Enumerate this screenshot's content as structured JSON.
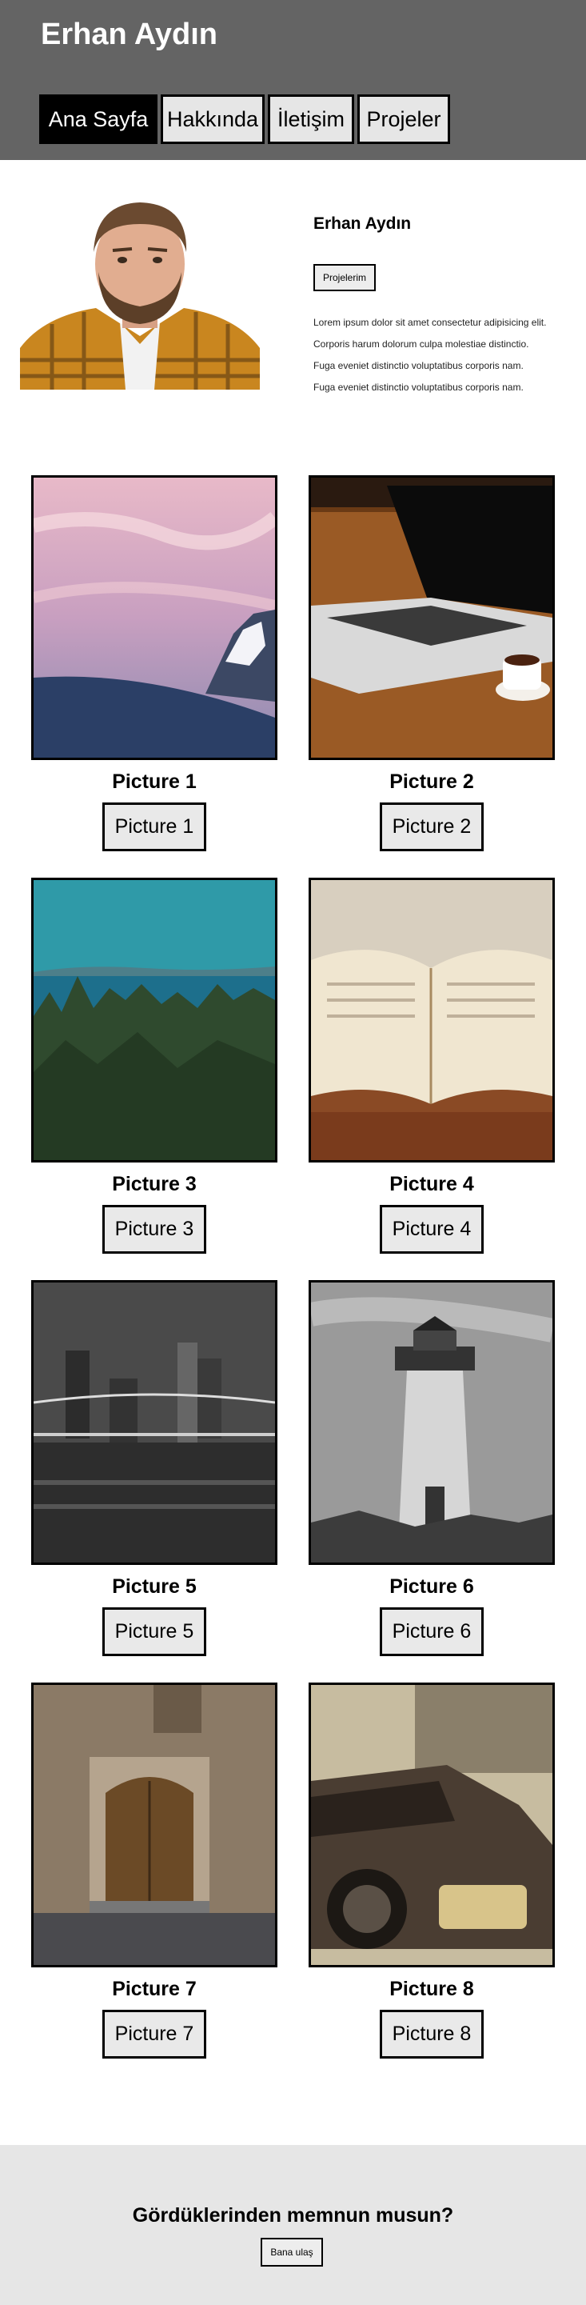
{
  "header": {
    "site_title": "Erhan Aydın",
    "nav": [
      "Ana Sayfa",
      "Hakkında",
      "İletişim",
      "Projeler"
    ],
    "active_index": 0
  },
  "profile": {
    "name": "Erhan Aydın",
    "button_label": "Projelerim",
    "lines": [
      "Lorem ipsum dolor sit amet consectetur adipisicing elit.",
      "Corporis harum dolorum culpa molestiae distinctio.",
      "Fuga eveniet distinctio voluptatibus corporis nam.",
      "Fuga eveniet distinctio voluptatibus corporis nam."
    ]
  },
  "gallery": [
    {
      "title": "Picture 1",
      "button": "Picture 1",
      "image": "snowy-mountain-sunset-photo"
    },
    {
      "title": "Picture 2",
      "button": "Picture 2",
      "image": "laptop-coffee-photo"
    },
    {
      "title": "Picture 3",
      "button": "Picture 3",
      "image": "forest-lake-photo"
    },
    {
      "title": "Picture 4",
      "button": "Picture 4",
      "image": "open-book-photo"
    },
    {
      "title": "Picture 5",
      "button": "Picture 5",
      "image": "city-bridge-night-photo"
    },
    {
      "title": "Picture 6",
      "button": "Picture 6",
      "image": "lighthouse-photo"
    },
    {
      "title": "Picture 7",
      "button": "Picture 7",
      "image": "old-wooden-door-photo"
    },
    {
      "title": "Picture 8",
      "button": "Picture 8",
      "image": "vintage-car-photo"
    }
  ],
  "footer": {
    "question": "Gördüklerinden memnun musun?",
    "button_label": "Bana ulaş"
  }
}
